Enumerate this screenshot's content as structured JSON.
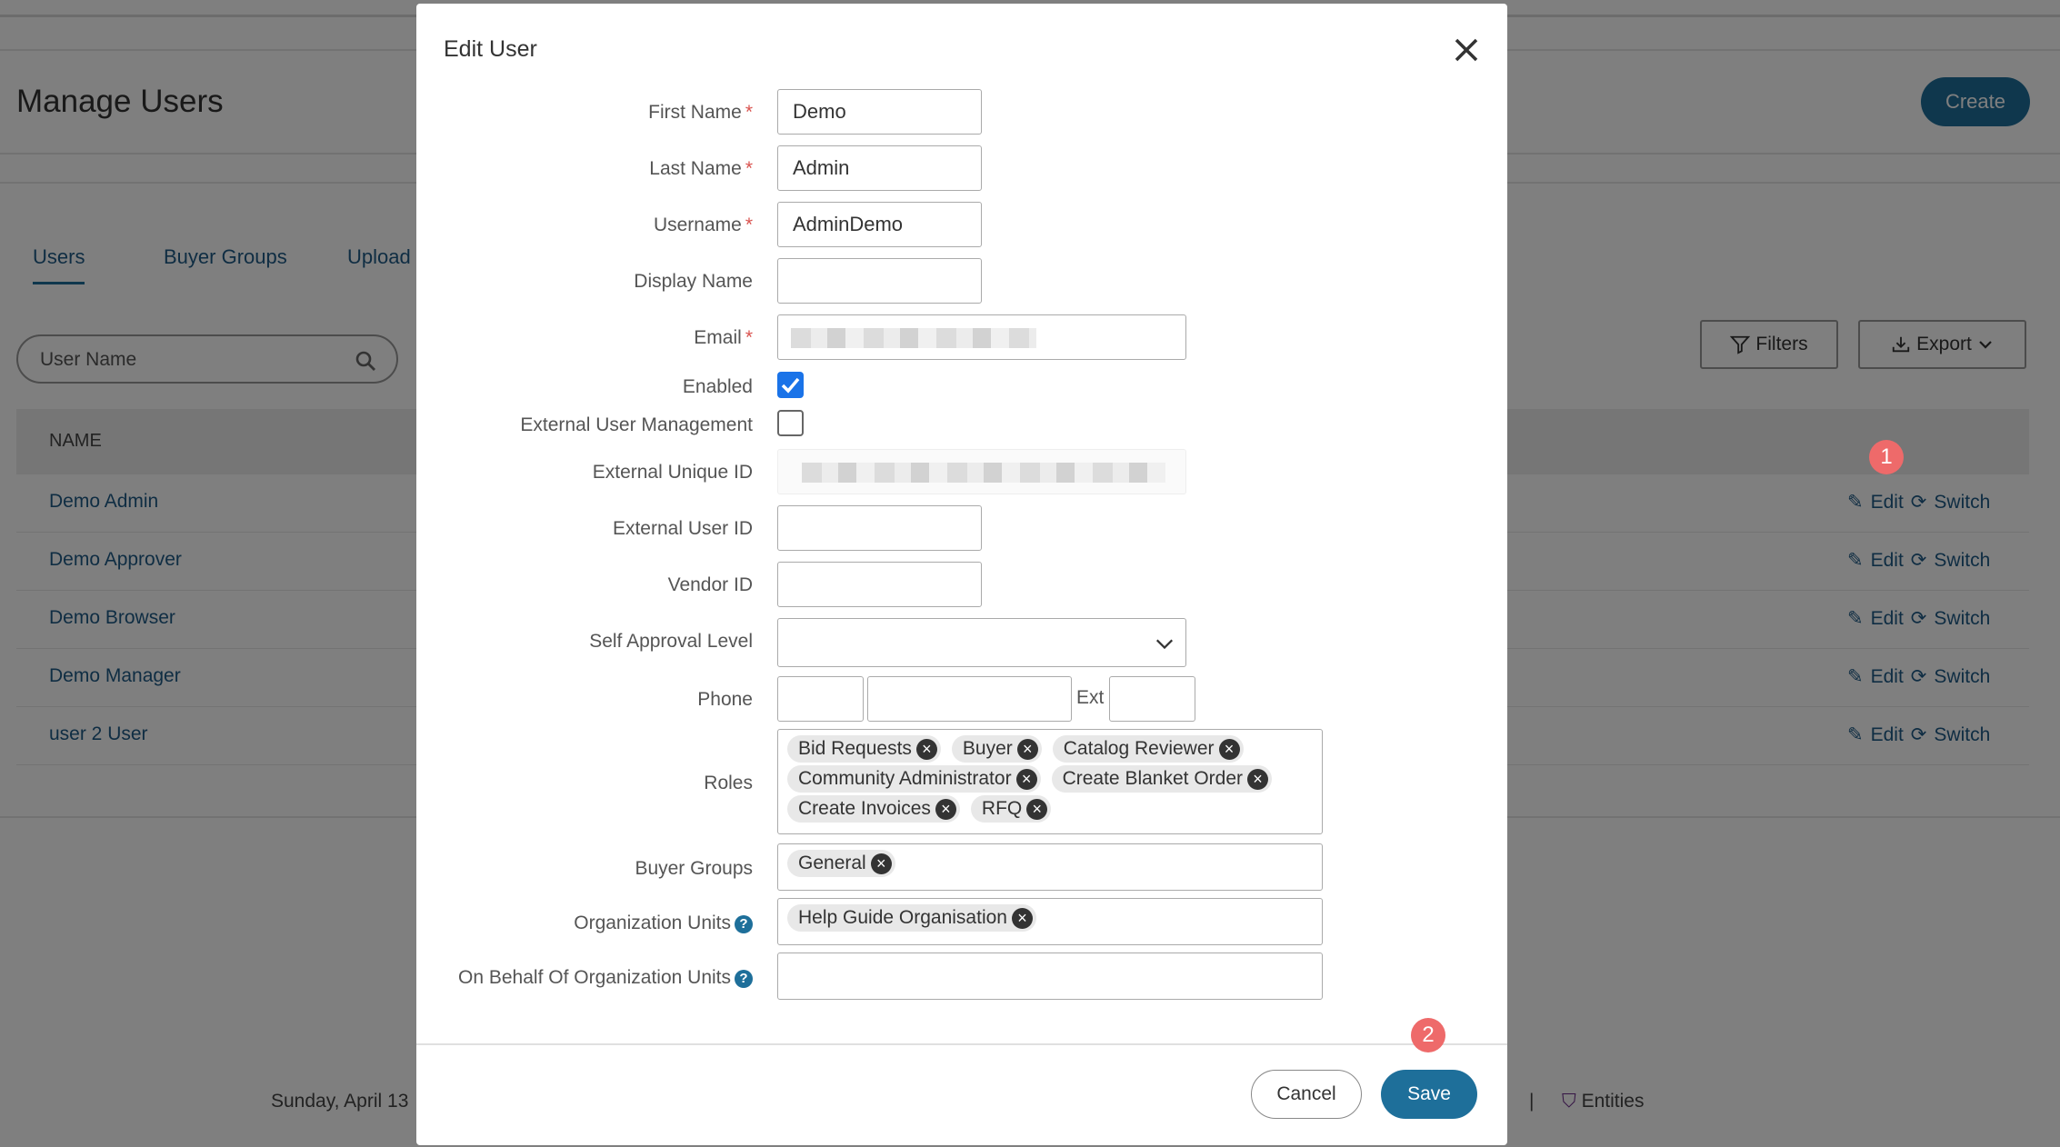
{
  "page": {
    "title": "Manage Users",
    "create_label": "Create",
    "tabs": [
      "Users",
      "Buyer Groups",
      "Upload"
    ],
    "search_placeholder": "User Name",
    "filters_label": "Filters",
    "export_label": "Export",
    "column_name": "NAME",
    "users": [
      "Demo Admin",
      "Demo Approver",
      "Demo Browser",
      "Demo Manager",
      "user 2 User"
    ],
    "edit_label": "Edit",
    "switch_label": "Switch",
    "footer_date": "Sunday, April 13",
    "footer_sep": "|",
    "footer_entities": "Entities"
  },
  "modal": {
    "title": "Edit User",
    "labels": {
      "first_name": "First Name",
      "last_name": "Last Name",
      "username": "Username",
      "display_name": "Display Name",
      "email": "Email",
      "enabled": "Enabled",
      "external_user_management": "External User Management",
      "external_unique_id": "External Unique ID",
      "external_user_id": "External User ID",
      "vendor_id": "Vendor ID",
      "self_approval_level": "Self Approval Level",
      "phone": "Phone",
      "ext": "Ext",
      "roles": "Roles",
      "buyer_groups": "Buyer Groups",
      "organization_units": "Organization Units",
      "on_behalf_of_organization_units": "On Behalf Of Organization Units"
    },
    "required_mark": "*",
    "values": {
      "first_name": "Demo",
      "last_name": "Admin",
      "username": "AdminDemo",
      "display_name": "",
      "enabled": true,
      "external_user_management": false,
      "external_user_id": "",
      "vendor_id": "",
      "self_approval_level": ""
    },
    "roles": [
      "Bid Requests",
      "Buyer",
      "Catalog Reviewer",
      "Community Administrator",
      "Create Blanket Order",
      "Create Invoices",
      "RFQ"
    ],
    "buyer_groups": [
      "General"
    ],
    "organization_units": [
      "Help Guide Organisation"
    ],
    "tag_remove": "×",
    "help_glyph": "?",
    "cancel_label": "Cancel",
    "save_label": "Save"
  },
  "markers": [
    "1",
    "2"
  ],
  "colors": {
    "primary": "#1e6f9a",
    "link": "#1e5a86",
    "required": "#d9534f",
    "checkbox": "#1a73e8",
    "marker": "#ee6a6a"
  }
}
